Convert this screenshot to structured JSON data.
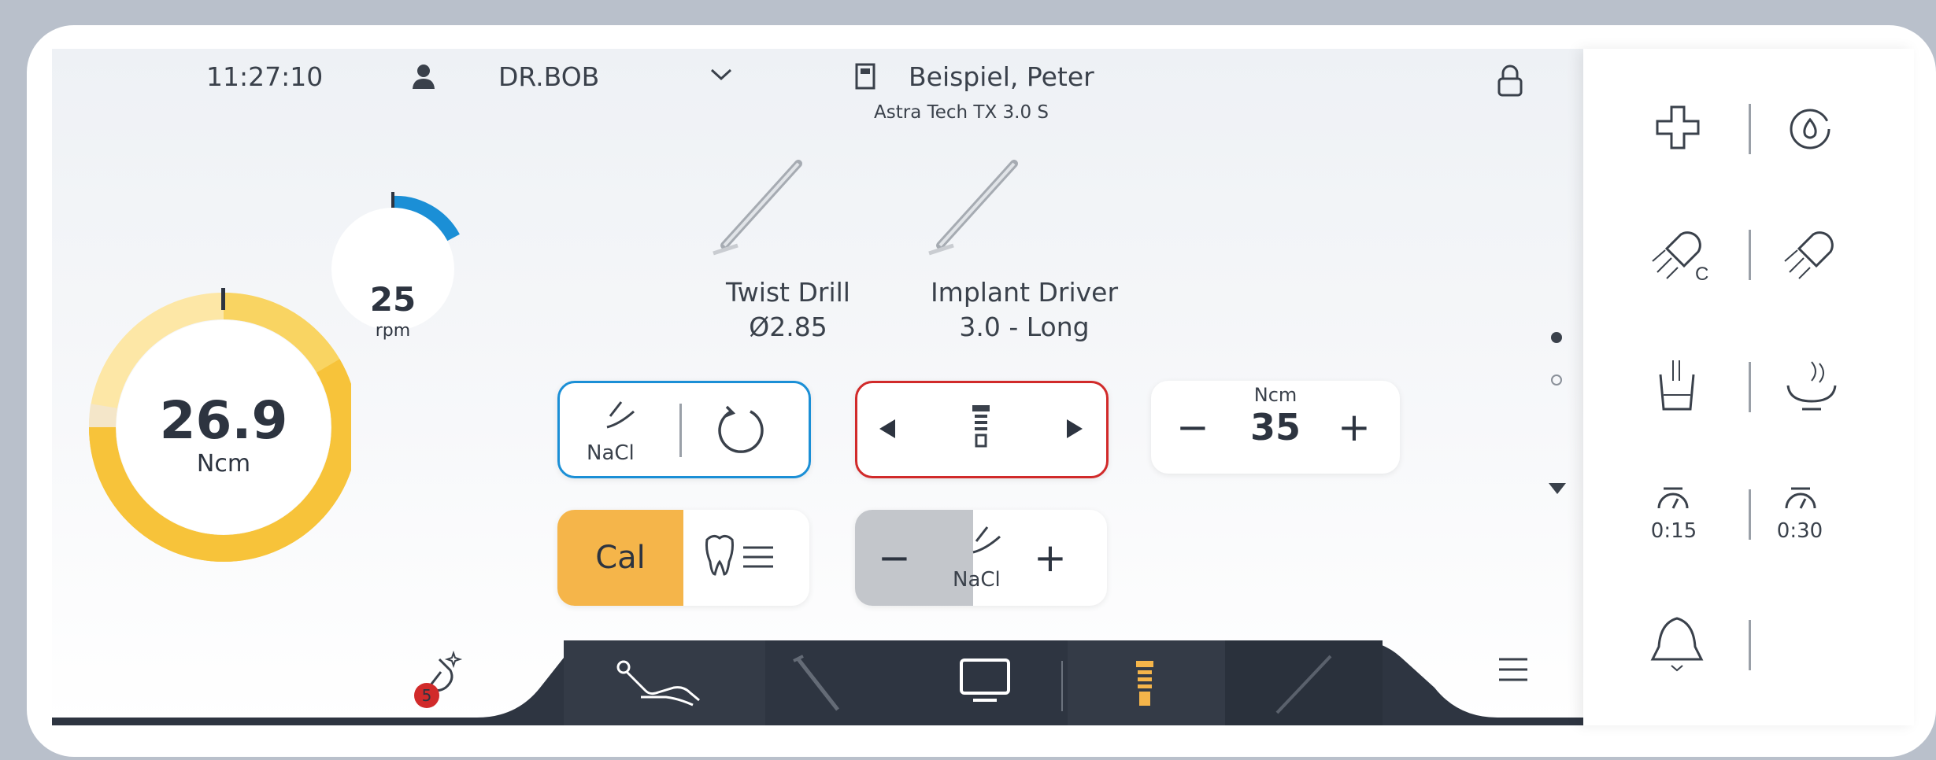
{
  "header": {
    "time": "11:27:10",
    "user": "DR.BOB",
    "patient": "Beispiel, Peter",
    "implant": "Astra Tech TX 3.0 S"
  },
  "gauges": {
    "torque_value": "26.9",
    "torque_unit": "Ncm",
    "speed_value": "25",
    "speed_unit": "rpm"
  },
  "instruments": [
    {
      "name": "Twist Drill",
      "detail": "Ø2.85"
    },
    {
      "name": "Implant Driver",
      "detail": "3.0 - Long"
    }
  ],
  "controls": {
    "coolant_label": "NaCl",
    "torque_limit_unit": "Ncm",
    "torque_limit_value": "35",
    "minus": "−",
    "plus": "+",
    "cal_label": "Cal",
    "coolant_label2": "NaCl"
  },
  "notifications": {
    "count": "5"
  },
  "side": {
    "timer1": "0:15",
    "timer2": "0:30"
  },
  "colors": {
    "accent_blue": "#1b8fd6",
    "accent_red": "#d12a2a",
    "accent_orange": "#f5b54a",
    "gauge_yellow": "#f7c33a",
    "nav_dark": "#2e3541"
  }
}
